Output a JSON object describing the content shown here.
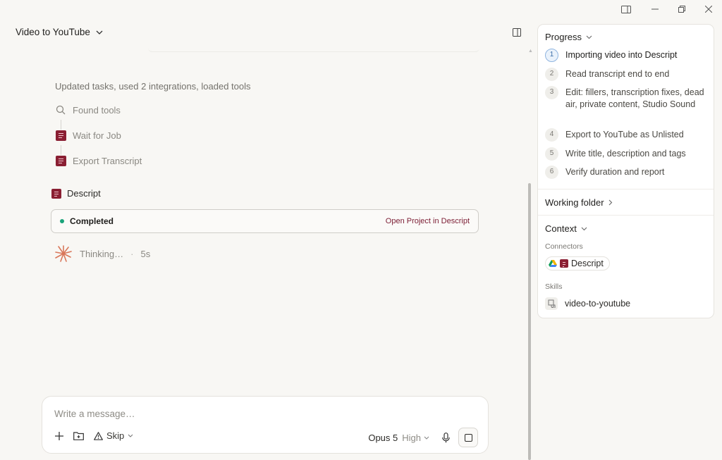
{
  "window": {
    "controls": [
      "split-view",
      "minimize",
      "restore",
      "close"
    ]
  },
  "chat": {
    "title": "Video to YouTube",
    "summary": "Updated tasks, used 2 integrations, loaded tools",
    "steps": [
      {
        "label": "Found tools",
        "icon": "search-icon"
      },
      {
        "label": "Wait for Job",
        "icon": "descript-icon"
      },
      {
        "label": "Export Transcript",
        "icon": "descript-icon"
      }
    ],
    "integration": {
      "name": "Descript",
      "status": "Completed",
      "link": "Open Project in Descript",
      "status_color": "#1aa37a",
      "link_color": "#7b1c33"
    },
    "thinking": {
      "label": "Thinking…",
      "separator": "·",
      "elapsed": "5s"
    }
  },
  "composer": {
    "placeholder": "Write a message…",
    "skip_label": "Skip",
    "model": "Opus 5",
    "effort": "High"
  },
  "panel": {
    "progress": {
      "title": "Progress",
      "items": [
        {
          "num": "1",
          "text": "Importing video into Descript",
          "active": true
        },
        {
          "num": "2",
          "text": "Read transcript end to end"
        },
        {
          "num": "3",
          "text": "Edit: fillers, transcription fixes, dead air, private content, Studio Sound"
        },
        {
          "num": "4",
          "text": "Export to YouTube as Unlisted"
        },
        {
          "num": "5",
          "text": "Write title, description and tags"
        },
        {
          "num": "6",
          "text": "Verify duration and report"
        }
      ]
    },
    "working_folder": {
      "title": "Working folder"
    },
    "context": {
      "title": "Context",
      "connectors_label": "Connectors",
      "connector_name": "Descript",
      "skills_label": "Skills",
      "skill_name": "video-to-youtube"
    }
  }
}
